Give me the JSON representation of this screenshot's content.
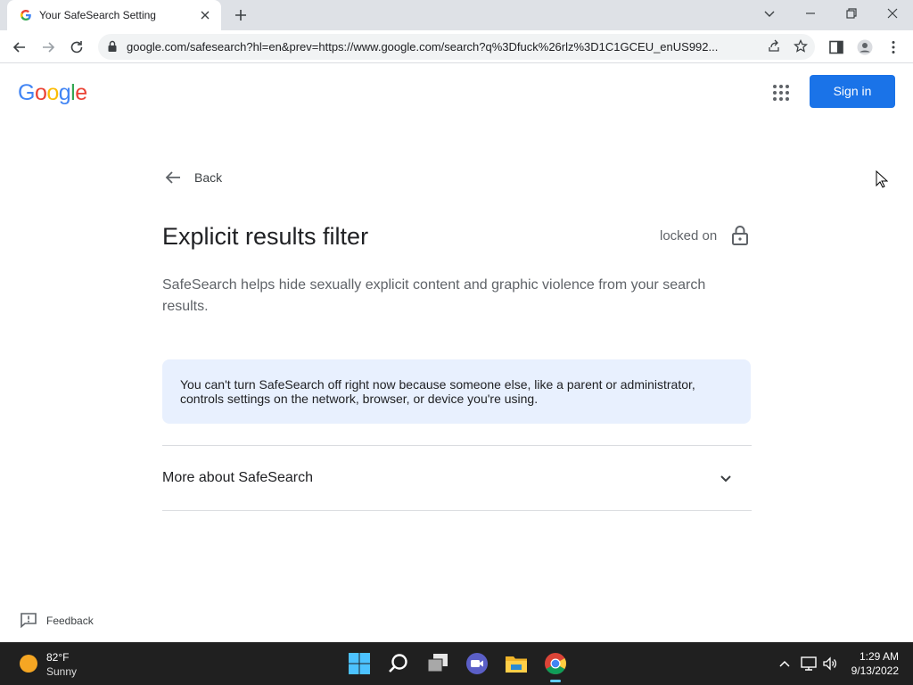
{
  "browser": {
    "tab_title": "Your SafeSearch Setting",
    "url": "google.com/safesearch?hl=en&prev=https://www.google.com/search?q%3Dfuck%26rlz%3D1C1GCEU_enUS992..."
  },
  "header": {
    "logo": [
      "G",
      "o",
      "o",
      "g",
      "l",
      "e"
    ],
    "logo_colors": [
      "#4285f4",
      "#ea4335",
      "#fbbc05",
      "#4285f4",
      "#34a853",
      "#ea4335"
    ],
    "signin_label": "Sign in",
    "accent": "#1a73e8"
  },
  "main": {
    "back_label": "Back",
    "title": "Explicit results filter",
    "status": "locked on",
    "description": "SafeSearch helps hide sexually explicit content and graphic violence from your search results.",
    "notice": "You can't turn SafeSearch off right now because someone else, like a parent or administrator, controls settings on the network, browser, or device you're using.",
    "notice_bg": "#e8f0fe",
    "more_label": "More about SafeSearch"
  },
  "footer": {
    "feedback_label": "Feedback"
  },
  "taskbar": {
    "temperature": "82°F",
    "condition": "Sunny",
    "time": "1:29 AM",
    "date": "9/13/2022",
    "apps": [
      "start-icon",
      "search-icon",
      "task-view-icon",
      "teams-chat-icon",
      "file-explorer-icon",
      "chrome-icon"
    ]
  }
}
